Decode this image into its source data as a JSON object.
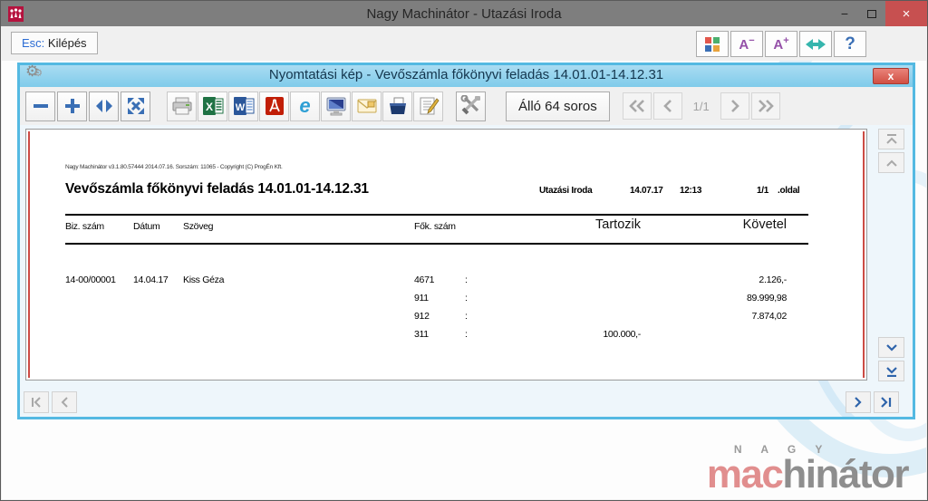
{
  "window": {
    "title": "Nagy Machinátor - Utazási Iroda",
    "minimize": "−",
    "close": "×"
  },
  "main_toolbar": {
    "esc_prefix": "Esc:",
    "esc_label": " Kilépés",
    "font_decrease": "A",
    "font_decrease_sign": "−",
    "font_increase": "A",
    "font_increase_sign": "+",
    "help": "?"
  },
  "preview": {
    "title": "Nyomtatási kép - Vevőszámla főkönyvi feladás 14.01.01-14.12.31",
    "close": "x",
    "ie_glyph": "e",
    "layout_button": "Álló 64 soros",
    "page_indicator": "1/1"
  },
  "report": {
    "app_info": "Nagy Machinátor v3.1.80.57444 2014.07.16. Sorszám: 11065 - Copyright (C) ProgÉn Kft.",
    "title": "Vevőszámla főkönyvi feladás 14.01.01-14.12.31",
    "office": "Utazási Iroda",
    "date": "14.07.17",
    "time": "12:13",
    "page": "1/1",
    "page_suffix": ".oldal",
    "columns": {
      "biz": "Biz. szám",
      "datum": "Dátum",
      "szoveg": "Szöveg",
      "fok": "Fők. szám",
      "tartozik": "Tartozik",
      "kovetel": "Követel"
    },
    "rows": [
      {
        "biz": "14-00/00001",
        "datum": "14.04.17",
        "szoveg": "Kiss Géza",
        "fok": "4671",
        "sep": ":",
        "tartozik": "",
        "kovetel": "2.126,-"
      },
      {
        "biz": "",
        "datum": "",
        "szoveg": "",
        "fok": "911",
        "sep": ":",
        "tartozik": "",
        "kovetel": "89.999,98"
      },
      {
        "biz": "",
        "datum": "",
        "szoveg": "",
        "fok": "912",
        "sep": ":",
        "tartozik": "",
        "kovetel": "7.874,02"
      },
      {
        "biz": "",
        "datum": "",
        "szoveg": "",
        "fok": "311",
        "sep": ":",
        "tartozik": "100.000,-",
        "kovetel": ""
      }
    ]
  },
  "logo": {
    "top": "N A G Y",
    "accent": "mac",
    "rest": "hinátor"
  },
  "colors": {
    "titlebar_gray": "#7e7e7e",
    "close_red": "#c75050",
    "preview_titlebar_blue": "#7fcbea",
    "preview_border_blue": "#54b9e2",
    "icon_blue": "#3a6fb5",
    "accent_purple": "#9450a8",
    "accent_teal": "#35b5ad",
    "logo_pink": "#e18e8e",
    "logo_gray": "#8e8e8e",
    "page_margin_red": "#cc4b44",
    "app_icon_red": "#b5123e"
  }
}
